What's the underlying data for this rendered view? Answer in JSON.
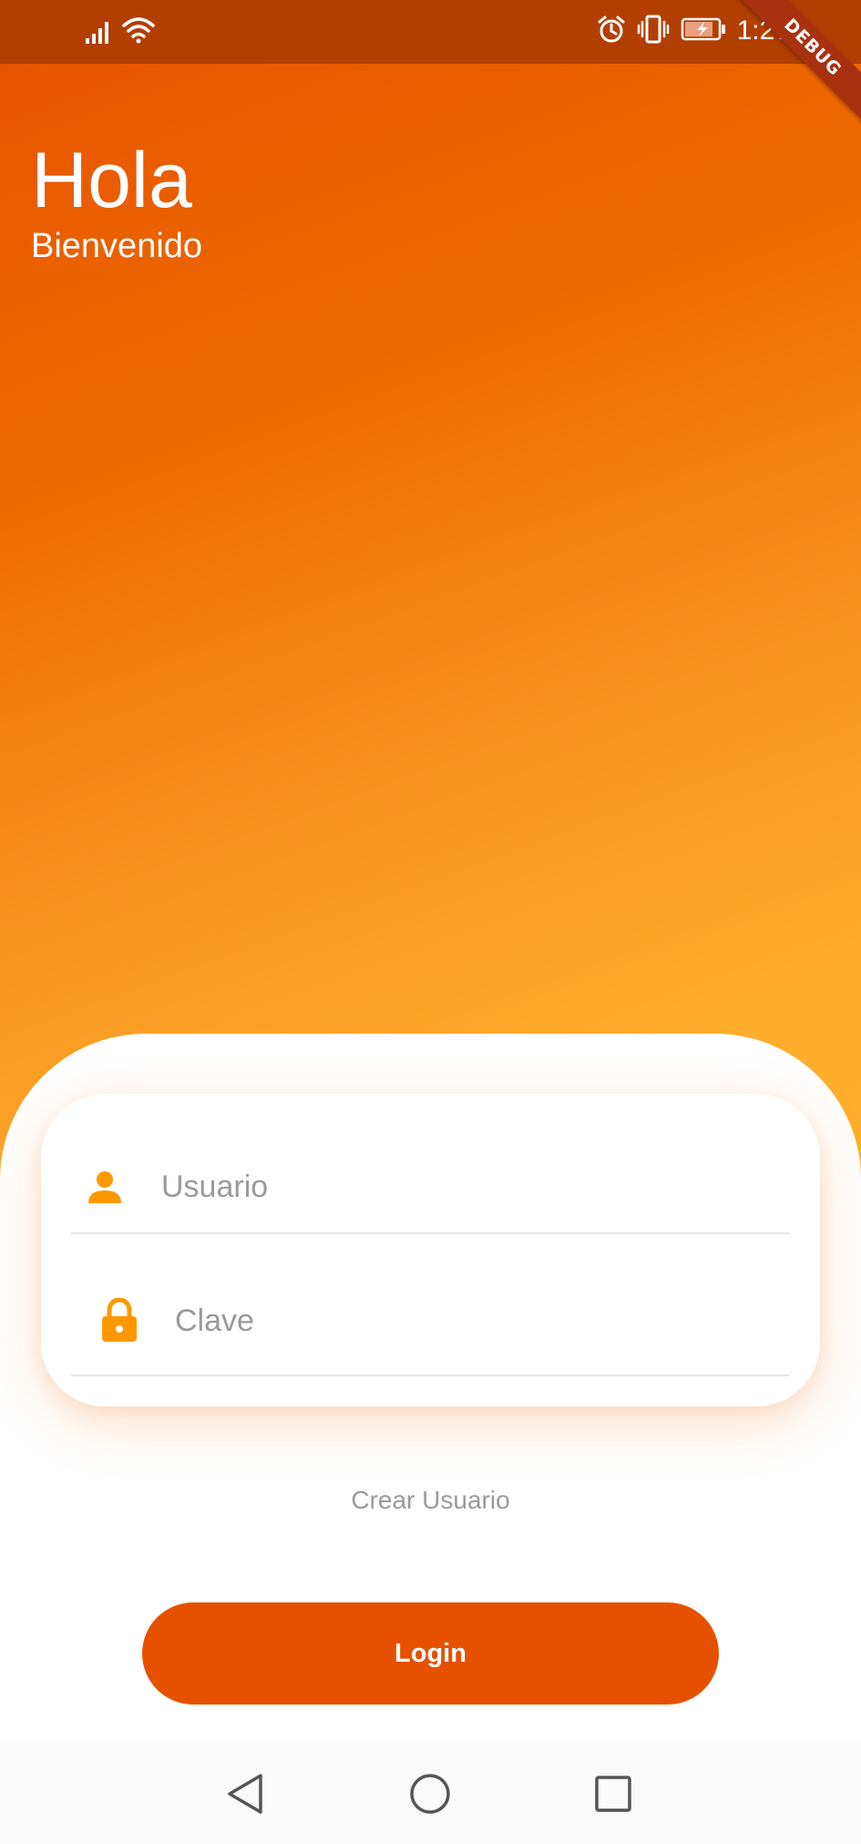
{
  "status_bar": {
    "time": "1:27",
    "icons": [
      "signal-icon",
      "wifi-icon",
      "alarm-icon",
      "vibrate-icon",
      "battery-icon"
    ]
  },
  "debug_banner": "DEBUG",
  "header": {
    "title": "Hola",
    "subtitle": "Bienvenido"
  },
  "form": {
    "username_placeholder": "Usuario",
    "password_placeholder": "Clave",
    "username_icon": "person-icon",
    "password_icon": "lock-icon"
  },
  "create_user_label": "Crear Usuario",
  "login_label": "Login",
  "nav": [
    "back-icon",
    "home-icon",
    "recents-icon"
  ],
  "colors": {
    "primary": "#e65100",
    "accent": "#ff9800",
    "gradient_end": "#ffab2b",
    "hint": "#9a9a9a"
  }
}
